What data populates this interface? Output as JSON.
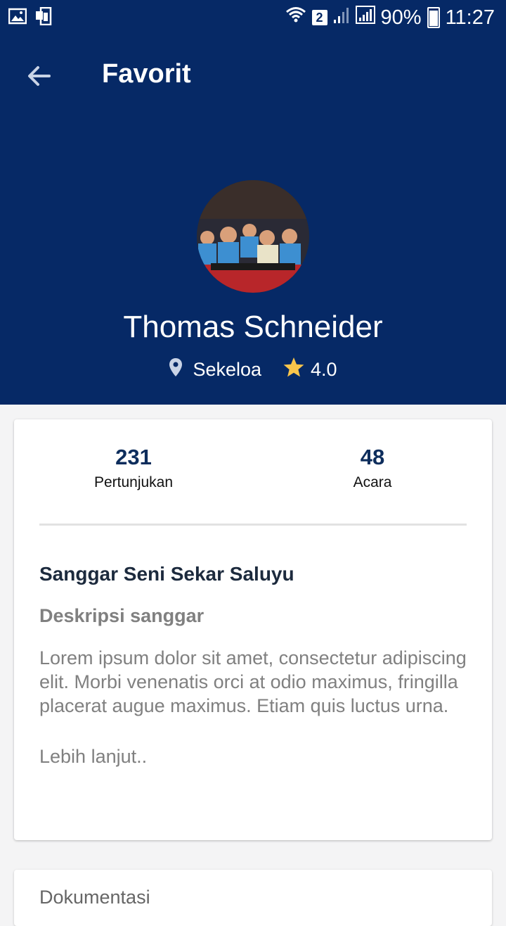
{
  "status_bar": {
    "sim_badge": "2",
    "battery": "90%",
    "time": "11:27"
  },
  "toolbar": {
    "title": "Favorit"
  },
  "profile": {
    "name": "Thomas Schneider",
    "location": "Sekeloa",
    "rating": "4.0"
  },
  "stats": [
    {
      "value": "231",
      "label": "Pertunjukan"
    },
    {
      "value": "48",
      "label": "Acara"
    }
  ],
  "studio": {
    "name": "Sanggar Seni Sekar Saluyu",
    "description_label": "Deskripsi sanggar",
    "description": "Lorem ipsum dolor sit amet, consectetur adipiscing elit. Morbi venenatis orci at odio maximus, fringilla placerat augue maximus. Etiam quis luctus urna.",
    "more": "Lebih lanjut.."
  },
  "documentation": {
    "title": "Dokumentasi"
  },
  "colors": {
    "header_bg": "#062966",
    "star": "#f9c54b",
    "stat_value": "#0d2d5c"
  }
}
